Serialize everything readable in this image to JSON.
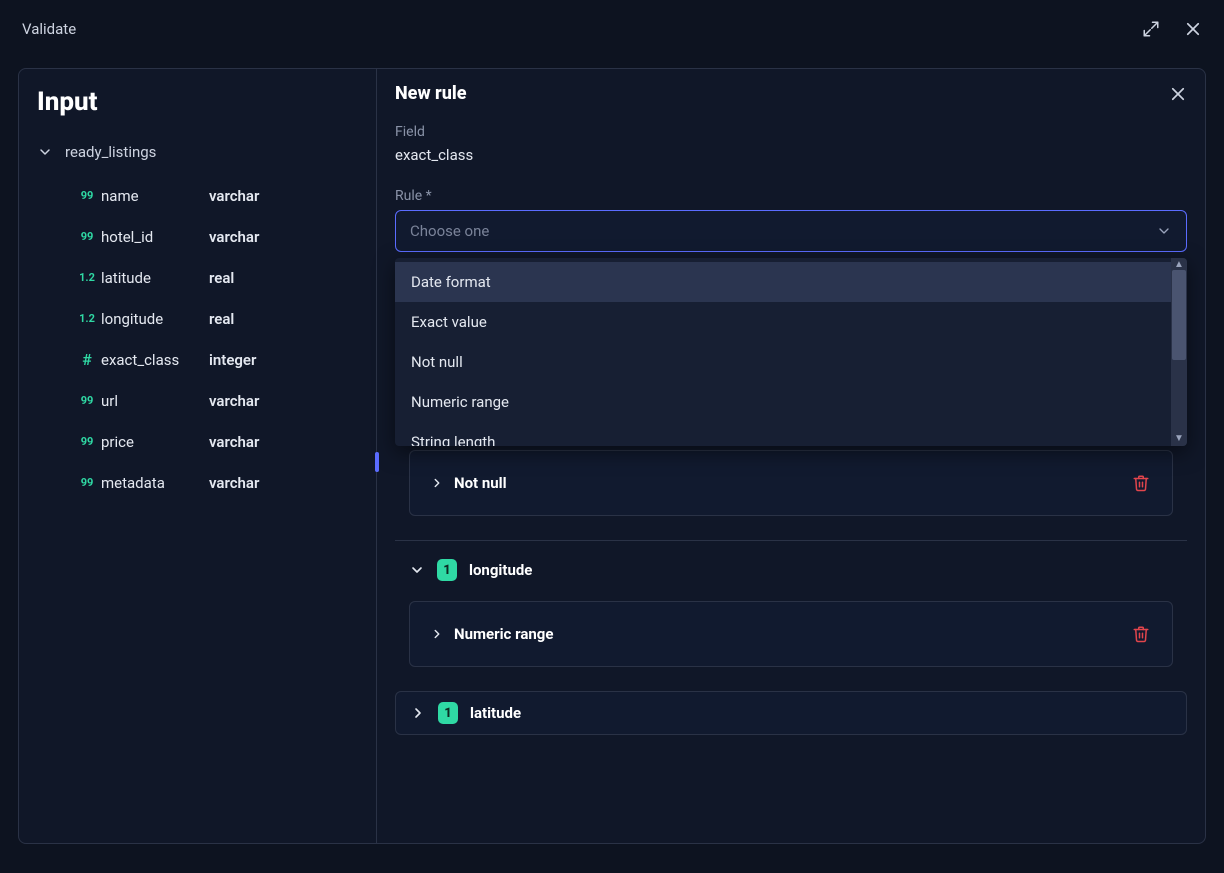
{
  "topbar": {
    "title": "Validate"
  },
  "input": {
    "heading": "Input",
    "table_name": "ready_listings",
    "fields": [
      {
        "icon": "99",
        "name": "name",
        "type": "varchar"
      },
      {
        "icon": "99",
        "name": "hotel_id",
        "type": "varchar"
      },
      {
        "icon": "1.2",
        "name": "latitude",
        "type": "real"
      },
      {
        "icon": "1.2",
        "name": "longitude",
        "type": "real"
      },
      {
        "icon": "#",
        "name": "exact_class",
        "type": "integer"
      },
      {
        "icon": "99",
        "name": "url",
        "type": "varchar"
      },
      {
        "icon": "99",
        "name": "price",
        "type": "varchar"
      },
      {
        "icon": "99",
        "name": "metadata",
        "type": "varchar"
      }
    ]
  },
  "right": {
    "title": "New rule",
    "field_label": "Field",
    "field_value": "exact_class",
    "rule_label": "Rule *",
    "select_placeholder": "Choose one",
    "dropdown_options": [
      "Date format",
      "Exact value",
      "Not null",
      "Numeric range",
      "String length"
    ],
    "existing": {
      "orphan_rule": "Not null",
      "groups": [
        {
          "expanded": true,
          "count": "1",
          "name": "longitude",
          "rule": "Numeric range"
        },
        {
          "expanded": false,
          "count": "1",
          "name": "latitude"
        }
      ]
    }
  }
}
